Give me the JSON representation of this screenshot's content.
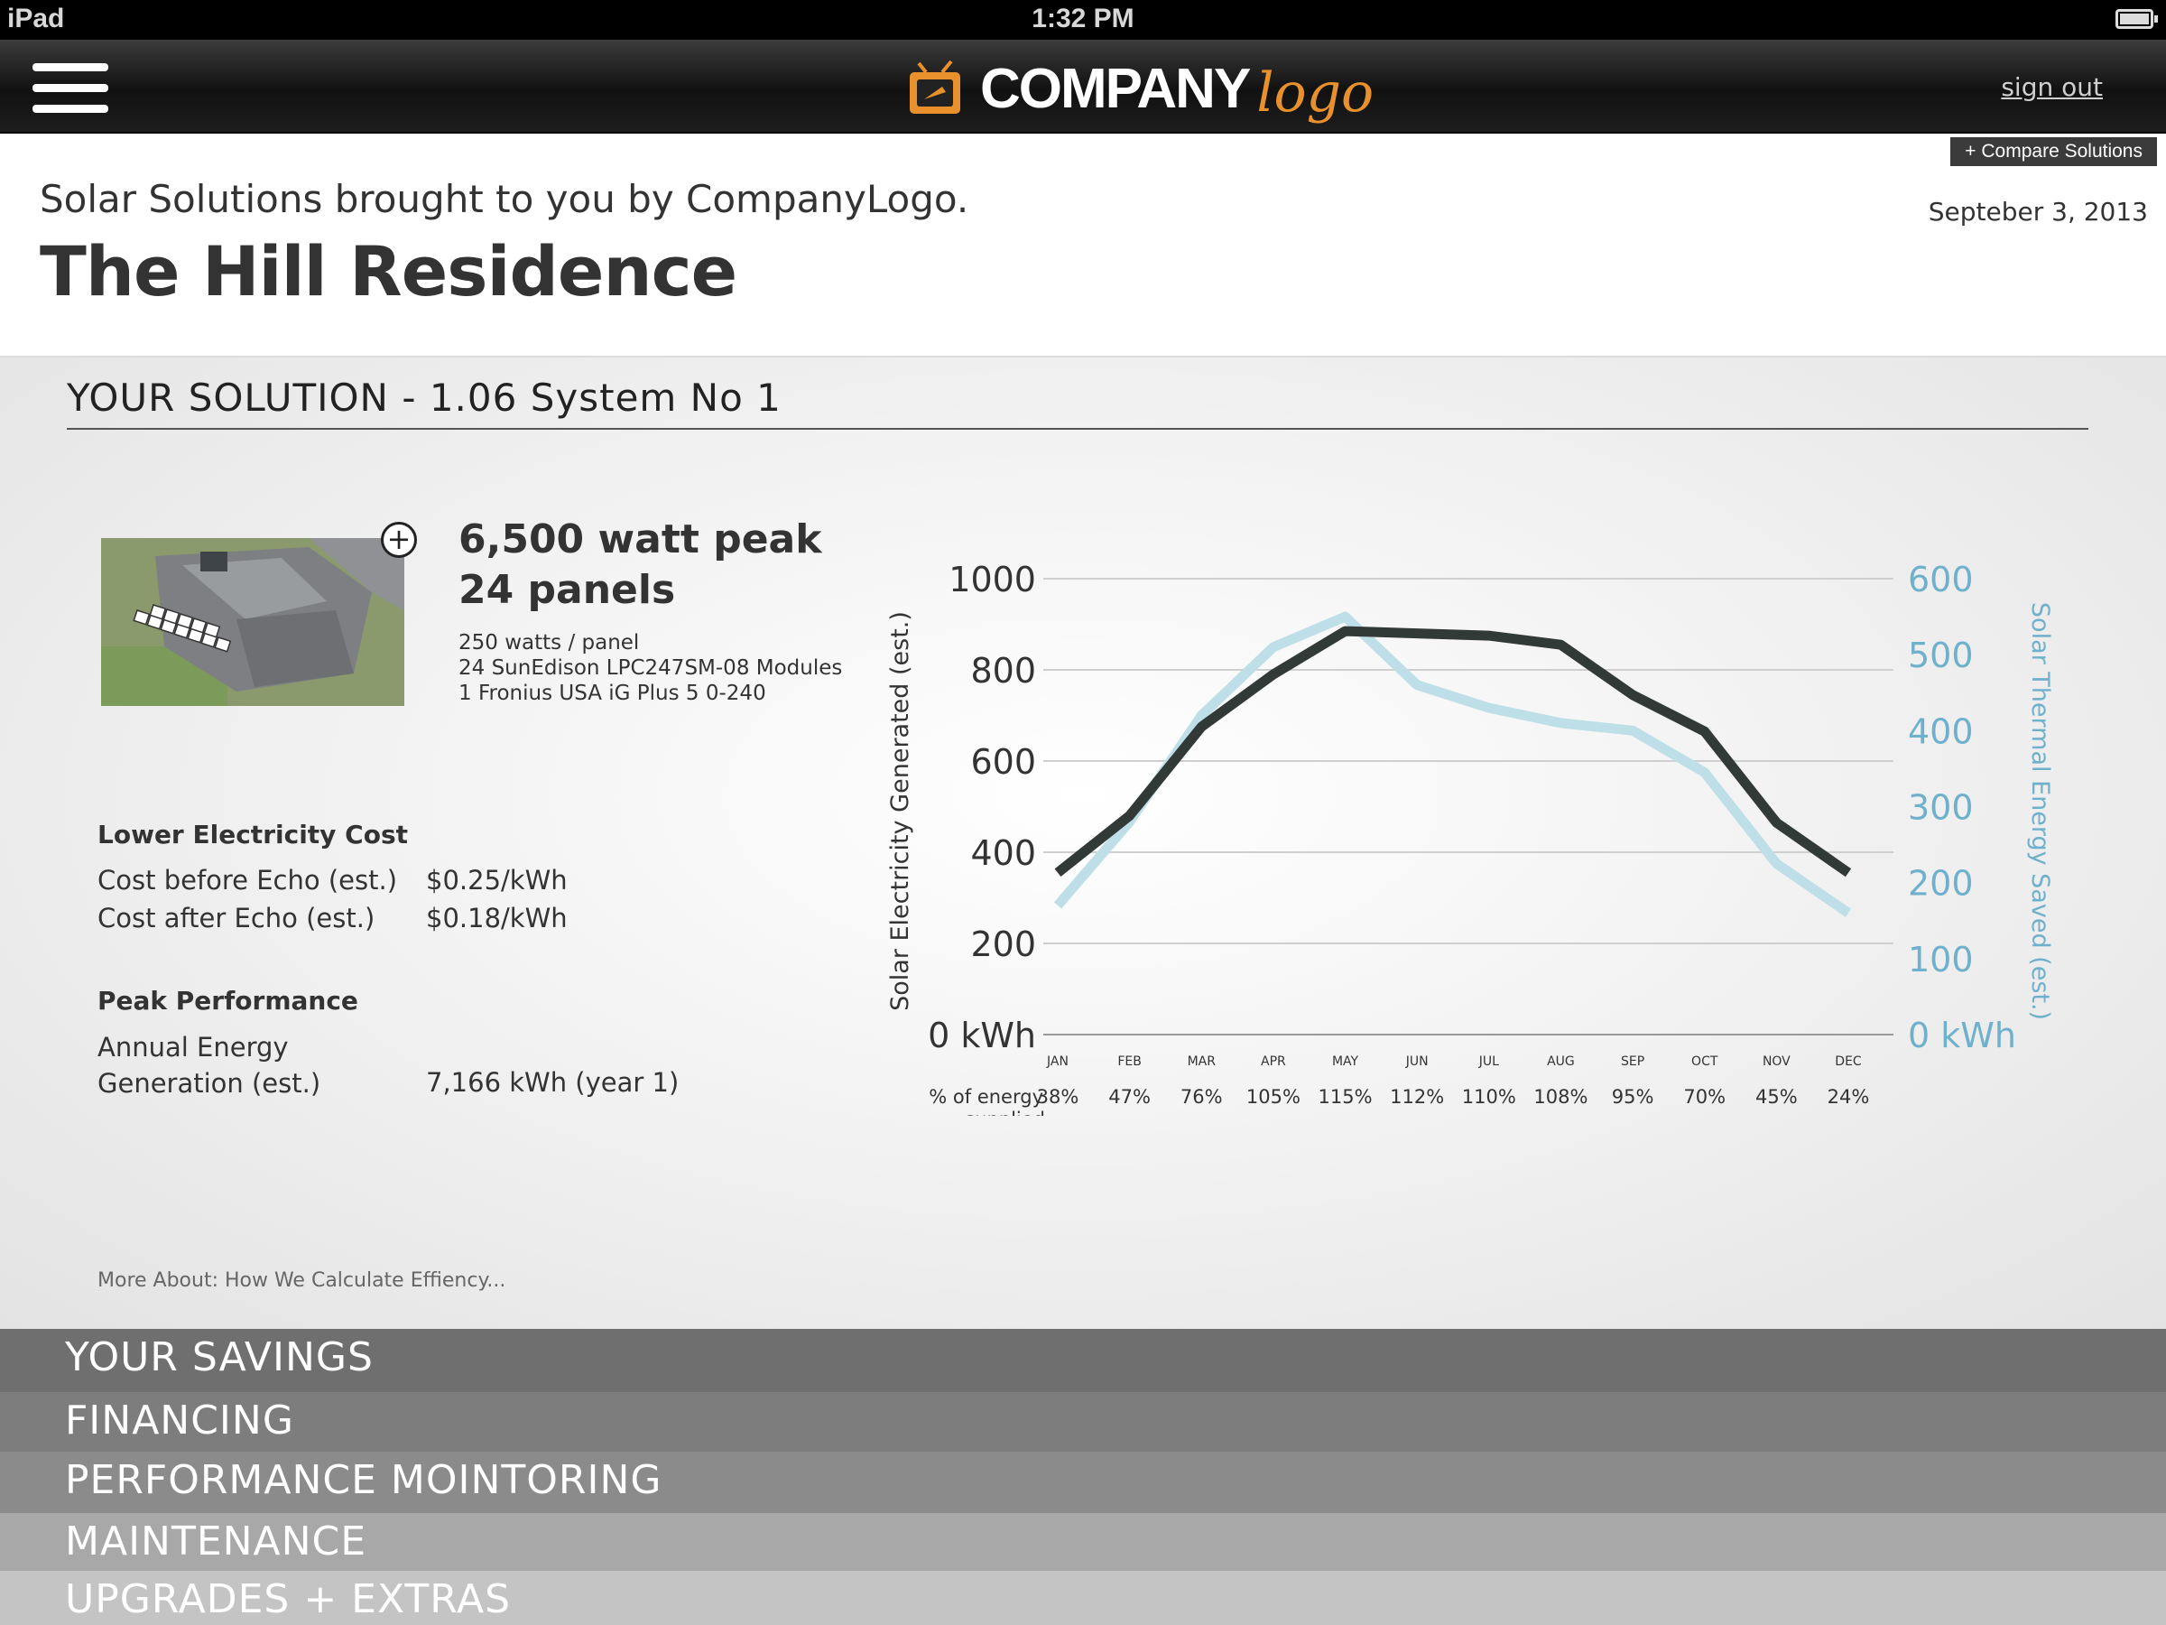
{
  "status_bar": {
    "device": "iPad",
    "time": "1:32 PM"
  },
  "header": {
    "logo_word": "COMPANY",
    "logo_script": "logo",
    "sign_out": "sign out",
    "compare": "+ Compare Solutions"
  },
  "intro": {
    "subtitle": "Solar Solutions brought to you by CompanyLogo.",
    "title": "The Hill Residence",
    "date": "Septeber 3, 2013"
  },
  "solution": {
    "title": "YOUR SOLUTION - 1.06 System No 1",
    "peak": "6,500 watt peak",
    "panels": "24 panels",
    "spec_lines": [
      "250 watts / panel",
      "24 SunEdison LPC247SM-08 Modules",
      "1 Fronius USA iG Plus 5 0-240"
    ],
    "cost_heading": "Lower Electricity Cost",
    "cost_before_label": "Cost before Echo (est.)",
    "cost_before_value": "$0.25/kWh",
    "cost_after_label": "Cost after Echo (est.)",
    "cost_after_value": "$0.18/kWh",
    "perf_heading": "Peak Performance",
    "perf_label": "Annual Energy Generation (est.)",
    "perf_value": "7,166 kWh (year 1)",
    "more_link": "More About: How We Calculate Effiency..."
  },
  "chart_data": {
    "type": "line",
    "categories": [
      "JAN",
      "FEB",
      "MAR",
      "APR",
      "MAY",
      "JUN",
      "JUL",
      "AUG",
      "SEP",
      "OCT",
      "NOV",
      "DEC"
    ],
    "series": [
      {
        "axis": "left",
        "color": "#323a38",
        "values": [
          355,
          480,
          675,
          790,
          885,
          880,
          875,
          855,
          745,
          665,
          465,
          355
        ]
      },
      {
        "axis": "right",
        "color": "#bfdfe8",
        "values": [
          170,
          280,
          420,
          510,
          550,
          460,
          430,
          410,
          400,
          345,
          225,
          160
        ]
      }
    ],
    "ylabel": "Solar Electricity Generated (est.)",
    "y2label": "Solar Thermal Energy Saved (est.)",
    "ylim": [
      0,
      1000
    ],
    "y2lim": [
      0,
      600
    ],
    "yticks": [
      "0 kWh",
      "200",
      "400",
      "600",
      "800",
      "1000"
    ],
    "y2ticks": [
      "0 kWh",
      "100",
      "200",
      "300",
      "400",
      "500",
      "600"
    ],
    "percent_label": "% of energy supplied (est.)",
    "percentages": [
      "38%",
      "47%",
      "76%",
      "105%",
      "115%",
      "112%",
      "110%",
      "108%",
      "95%",
      "70%",
      "45%",
      "24%"
    ],
    "grid": true,
    "right_axis_color": "#6fb0cc"
  },
  "accordion": [
    {
      "label": "YOUR SAVINGS",
      "color": "#6f6f6f"
    },
    {
      "label": "FINANCING",
      "color": "#7d7d7d"
    },
    {
      "label": "PERFORMANCE MOINTORING",
      "color": "#8b8b8b"
    },
    {
      "label": "MAINTENANCE",
      "color": "#a8a8a8"
    },
    {
      "label": "UPGRADES + EXTRAS",
      "color": "#c4c4c4"
    }
  ]
}
